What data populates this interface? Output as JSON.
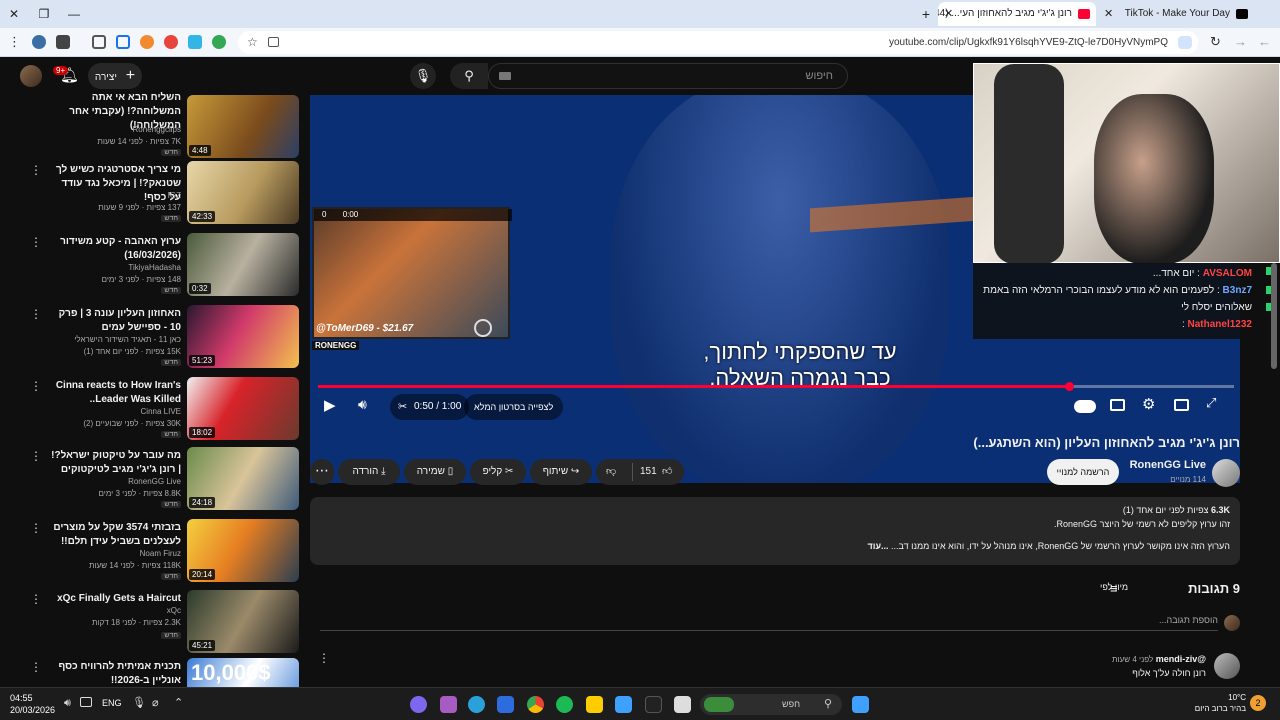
{
  "browser": {
    "tabs": [
      {
        "label": "רונן ג'יג'י מגיב להאחוזון העי... (44)"
      },
      {
        "label": "TikTok - Make Your Day"
      }
    ],
    "url": "youtube.com/clip/Ugkxfk91Y6lsqhYVE9-ZtQ-le7D0HyVNymPQ"
  },
  "header": {
    "search_placeholder": "חיפוש",
    "create_label": "יצירה",
    "notif_count": "9+"
  },
  "sidebar": [
    {
      "title": "השליח הבא אי אתה המשלוחה?! (עקבתי אחר המשלוחה!)",
      "channel": "Ronenggclips",
      "meta": "7K צפיות · לפני 14 שעות",
      "new": "חדש",
      "duration": "4:48"
    },
    {
      "title": "מי צריך אסטרטגיה כשיש לך שטנאק?! | מיכאל נגד עודד על כסף!",
      "channel": "IGZ",
      "meta": "137 צפיות · לפני 9 שעות",
      "new": "חדש",
      "duration": "42:33"
    },
    {
      "title": "ערוץ האהבה - קטע משידור (16/03/2026)",
      "channel": "TikiyaHadasha",
      "meta": "148 צפיות · לפני 3 ימים",
      "new": "חדש",
      "duration": "0:32"
    },
    {
      "title": "האחוזון העליון עונה 3 | פרק 10 - ספיישל עמים",
      "channel": "כאן 11 - תאגיד השידור הישראלי",
      "meta": "15K צפיות · לפני יום אחד (1)",
      "new": "חדש",
      "duration": "51:23"
    },
    {
      "title": "Cinna reacts to How Iran's Leader Was Killed..",
      "channel": "Cinna LIVE",
      "meta": "30K צפיות · לפני שבועיים (2)",
      "new": "חדש",
      "duration": "18:02"
    },
    {
      "title": "מה עובר על טיקטוק ישראל?! | רונן ג'יג'י מגיב לטיקטוקים",
      "channel": "RonenGG Live",
      "meta": "8.8K צפיות · לפני 3 ימים",
      "new": "חדש",
      "duration": "24:18"
    },
    {
      "title": "בזבזתי 3574 שקל על מוצרים לעצלנים בשביל עידן תלם!!",
      "channel": "Noam Firuz",
      "meta": "118K צפיות · לפני 14 שעות",
      "new": "חדש",
      "duration": "20:14"
    },
    {
      "title": "xQc Finally Gets a Haircut",
      "channel": "xQc",
      "meta": "2.3K צפיות · לפני 18 דקות",
      "new": "חדש",
      "duration": "45:21"
    },
    {
      "title": "תכנית אמיתית להרוויח כסף אונליין ב-2026!!",
      "channel": "",
      "meta": "",
      "new": "",
      "duration": ""
    }
  ],
  "player": {
    "subtitle_line1": "עד שהספקתי לחתוך,",
    "subtitle_line2": "כבר נגמרה השאלה.",
    "time": "0:50 / 1:00",
    "watch_full": "לצפייה בסרטון המלא",
    "progress": 0.82,
    "donation": "@ToMerD69 - $21.67",
    "inset_brand": "RONENGG",
    "inset_counters": [
      "0",
      "0:00"
    ],
    "chat": [
      {
        "user": "AVSALOM",
        "text": ": יום אחד..."
      },
      {
        "user": "B3nz7",
        "text": ": לפעמים הוא לא מודע לעצמו הבוכרי הרמלאי הזה באמת שאלוהים יסלח לי"
      },
      {
        "user": "Nathanel1232",
        "text": ":"
      }
    ]
  },
  "video": {
    "title": "רונן ג'יג'י מגיב להאחוזון העליון (הוא השתגע...)",
    "channel": "RonenGG Live",
    "subs": "114 מנויים",
    "subscribe": "הרשמה למנויי",
    "likes": "151",
    "share": "שיתוף",
    "clip": "קליפ",
    "save": "שמירה",
    "download": "הורדה"
  },
  "description": {
    "views": "6.3K",
    "views_label": "צפיות",
    "date": "לפני יום אחד (1)",
    "line1": "זהו ערוץ קליפים לא רשמי של היוצר RonenGG.",
    "line2": "הערוץ הזה אינו מקושר לערוץ הרשמי של RonenGG, אינו מנוהל על ידו, והוא אינו ממנו דב...",
    "more": "...עוד"
  },
  "comments": {
    "count_label": "9 תגובות",
    "sort": "מיון לפי",
    "add": "הוספת תגובה...",
    "first": {
      "author": "@mendi-ziv",
      "time": "לפני 4 שעות",
      "text": "רונן חולה על'ך אלוף"
    }
  },
  "taskbar": {
    "time": "04:55",
    "date": "20/03/2026",
    "lang": "ENG",
    "search": "חפש",
    "weather_temp": "10°C",
    "weather_desc": "בהיר ברוב היום",
    "badge": "2"
  },
  "colors": {
    "accent": "#ff0033",
    "player_bg": "#0b2f74",
    "chat_green": "#27d36b"
  }
}
